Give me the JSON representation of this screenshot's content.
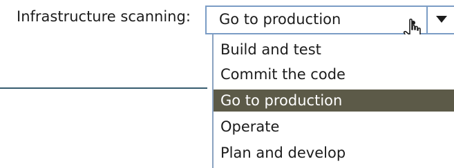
{
  "field": {
    "label": "Infrastructure scanning:"
  },
  "select": {
    "value": "Go to production",
    "arrow_icon": "triangle-down-icon",
    "cursor_icon": "hand-pointer-icon"
  },
  "dropdown": {
    "items": [
      {
        "label": "Build and test",
        "selected": false
      },
      {
        "label": "Commit the code",
        "selected": false
      },
      {
        "label": "Go to production",
        "selected": true
      },
      {
        "label": "Operate",
        "selected": false
      },
      {
        "label": "Plan and develop",
        "selected": false
      }
    ],
    "selected_color": "#5c5a48"
  },
  "colors": {
    "border": "#7a9cc5",
    "separator": "#355a6e"
  }
}
